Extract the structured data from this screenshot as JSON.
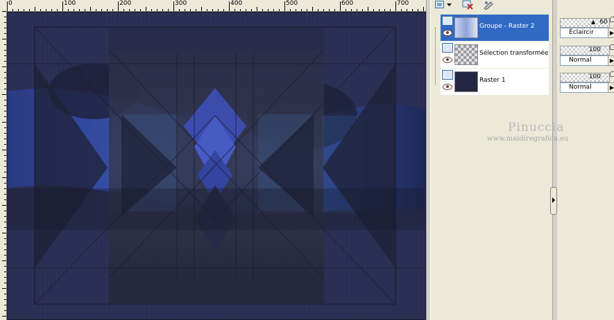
{
  "ruler": {
    "top_labels": [
      "0",
      "100",
      "200",
      "300",
      "400",
      "500",
      "600",
      "700"
    ]
  },
  "toolbar": {
    "icons": [
      "new-layer-icon",
      "dropdown-icon",
      "delete-layer-icon",
      "layer-properties-icon"
    ]
  },
  "layers": [
    {
      "name": "Groupe - Raster 2",
      "opacity": "60",
      "blend": "Éclaircir",
      "selected": true
    },
    {
      "name": "Sélection transformée",
      "opacity": "100",
      "blend": "Normal",
      "selected": false
    },
    {
      "name": "Raster 1",
      "opacity": "100",
      "blend": "Normal",
      "selected": false
    }
  ],
  "watermark": {
    "title": "Pinuccia",
    "url": "www.maidiregrafica.eu"
  },
  "colors": {
    "selection": "#316ac5",
    "canvas_base": "#2c2f52",
    "accent_blue": "#4a5fd0"
  }
}
